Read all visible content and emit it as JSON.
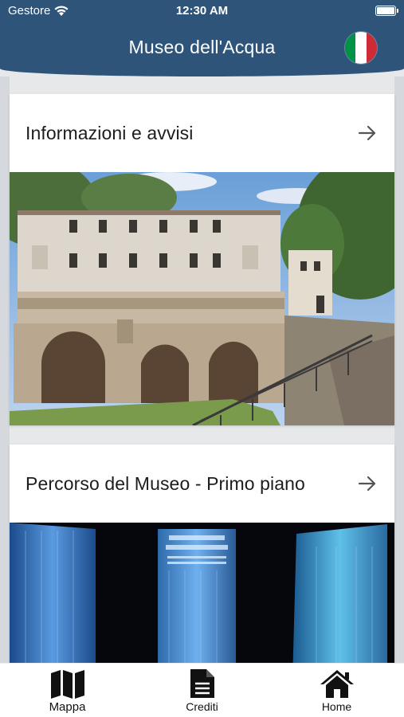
{
  "status_bar": {
    "carrier": "Gestore",
    "time": "12:30 AM"
  },
  "header": {
    "title": "Museo dell'Acqua",
    "language_flag": "italian-flag-icon",
    "flag_colors": [
      "#009246",
      "#ffffff",
      "#ce2b37"
    ]
  },
  "cards": [
    {
      "title": "Informazioni e avvisi",
      "image": "museum-building-photo"
    },
    {
      "title": "Percorso del Museo - Primo piano",
      "image": "exhibition-room-photo"
    }
  ],
  "bottom_nav": {
    "items": [
      {
        "label": "Mappa",
        "icon": "map-icon"
      },
      {
        "label": "Crediti",
        "icon": "document-icon"
      },
      {
        "label": "Home",
        "icon": "home-icon"
      }
    ]
  },
  "colors": {
    "header": "#2e5479",
    "background": "#e6e8ea",
    "card": "#ffffff"
  }
}
